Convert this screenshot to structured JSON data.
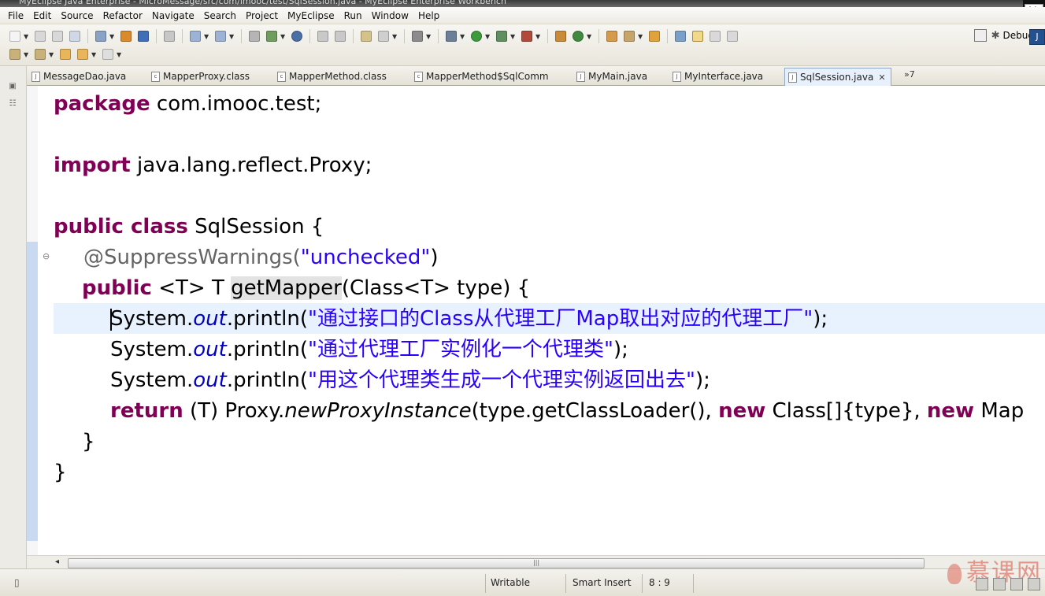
{
  "window": {
    "title": "MyEclipse Java Enterprise - MicroMessage/src/com/imooc/test/SqlSession.java - MyEclipse Enterprise Workbench",
    "ime_glyph": "管"
  },
  "menu": [
    "File",
    "Edit",
    "Source",
    "Refactor",
    "Navigate",
    "Search",
    "Project",
    "MyEclipse",
    "Run",
    "Window",
    "Help"
  ],
  "toolbar": {
    "perspective_label": "Debug"
  },
  "tabs": [
    {
      "label": "MessageDao.java",
      "active": false
    },
    {
      "label": "MapperProxy.class",
      "active": false
    },
    {
      "label": "MapperMethod.class",
      "active": false
    },
    {
      "label": "MapperMethod$SqlComm",
      "active": false
    },
    {
      "label": "MyMain.java",
      "active": false
    },
    {
      "label": "MyInterface.java",
      "active": false
    },
    {
      "label": "SqlSession.java",
      "active": true
    }
  ],
  "tab_overflow": "»7",
  "code": {
    "l1_kw": "package",
    "l1_rest": " com.imooc.test;",
    "l3_kw": "import",
    "l3_rest": " java.lang.reflect.Proxy;",
    "l5_kw1": "public",
    "l5_kw2": " class",
    "l5_rest": " SqlSession {",
    "l6_anno": "@SuppressWarnings(",
    "l6_str": "\"unchecked\"",
    "l6_end": ")",
    "l7_kw": "public",
    "l7_a": " <T> T ",
    "l7_method": "getMapper",
    "l7_b": "(Class<T> type) {",
    "l8_a": "System.",
    "l8_fld": "out",
    "l8_b": ".println(",
    "l8_str": "\"通过接口的Class从代理工厂Map取出对应的代理工厂\"",
    "l8_end": ");",
    "l9_a": "System.",
    "l9_fld": "out",
    "l9_b": ".println(",
    "l9_str": "\"通过代理工厂实例化一个代理类\"",
    "l9_end": ");",
    "l10_a": "System.",
    "l10_fld": "out",
    "l10_b": ".println(",
    "l10_str": "\"用这个代理类生成一个代理实例返回出去\"",
    "l10_end": ");",
    "l11_kw": "return",
    "l11_a": " (T) Proxy.",
    "l11_it": "newProxyInstance",
    "l11_b": "(type.getClassLoader(), ",
    "l11_kw2": "new",
    "l11_c": " Class[]{type}, ",
    "l11_kw3": "new",
    "l11_d": " Map",
    "l12": "}",
    "l13": "}"
  },
  "status": {
    "writable": "Writable",
    "insert_mode": "Smart Insert",
    "position": "8 : 9"
  },
  "watermark": "慕课网"
}
